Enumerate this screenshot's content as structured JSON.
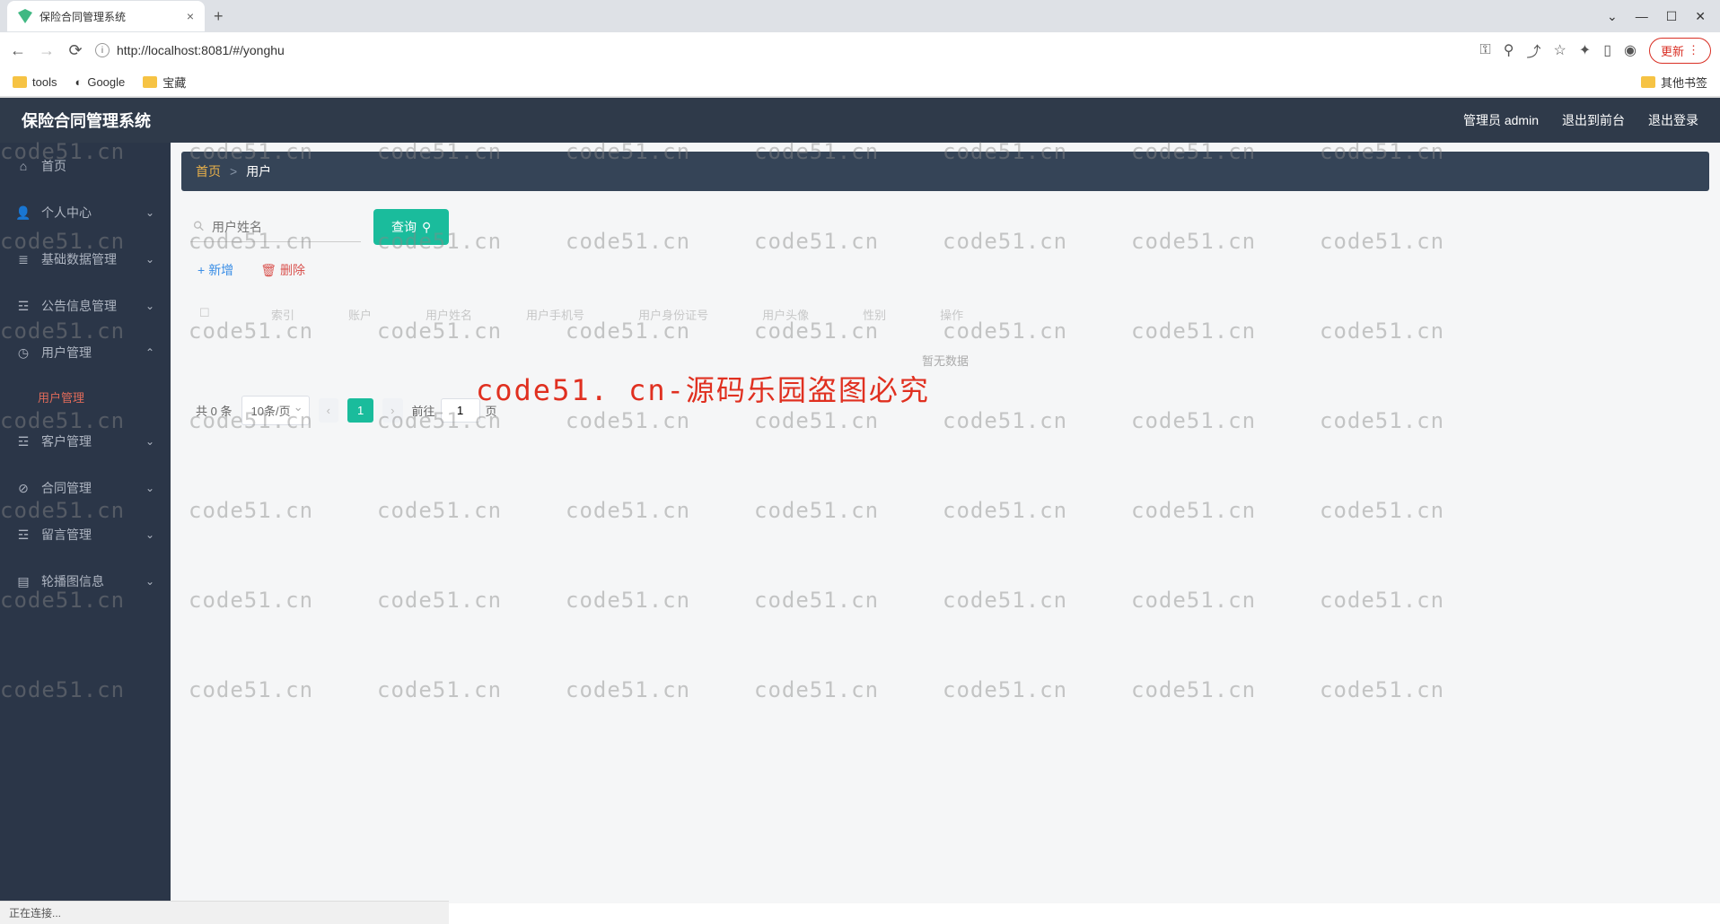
{
  "browser": {
    "tab_title": "保险合同管理系统",
    "url": "http://localhost:8081/#/yonghu",
    "update_label": "更新",
    "bookmarks": [
      "tools",
      "Google",
      "宝藏"
    ],
    "other_bookmarks": "其他书签"
  },
  "header": {
    "title": "保险合同管理系统",
    "user_label": "管理员 admin",
    "exit_front": "退出到前台",
    "logout": "退出登录"
  },
  "sidebar": {
    "items": [
      {
        "label": "首页",
        "icon": "⌂"
      },
      {
        "label": "个人中心",
        "icon": "👤",
        "chev": true
      },
      {
        "label": "基础数据管理",
        "icon": "≣",
        "chev": true
      },
      {
        "label": "公告信息管理",
        "icon": "☲",
        "chev": true
      },
      {
        "label": "用户管理",
        "icon": "◷",
        "chev": true,
        "expanded": true,
        "sub": "用户管理"
      },
      {
        "label": "客户管理",
        "icon": "☲",
        "chev": true
      },
      {
        "label": "合同管理",
        "icon": "⊘",
        "chev": true
      },
      {
        "label": "留言管理",
        "icon": "☲",
        "chev": true
      },
      {
        "label": "轮播图信息",
        "icon": "▤",
        "chev": true
      }
    ]
  },
  "breadcrumb": {
    "home": "首页",
    "sep": ">",
    "current": "用户"
  },
  "search": {
    "placeholder": "用户姓名",
    "query_btn": "查询"
  },
  "actions": {
    "add": "新增",
    "delete": "删除"
  },
  "table": {
    "headers": [
      "索引",
      "账户",
      "用户姓名",
      "用户手机号",
      "用户身份证号",
      "用户头像",
      "性别",
      "操作"
    ],
    "empty": "暂无数据"
  },
  "pagination": {
    "total_prefix": "共",
    "total_count": "0",
    "total_suffix": "条",
    "page_size": "10条/页",
    "current": "1",
    "goto_prefix": "前往",
    "goto_value": "1",
    "goto_suffix": "页"
  },
  "watermark": {
    "text": "code51.cn",
    "big": "code51. cn-源码乐园盗图必究"
  },
  "status": "正在连接..."
}
